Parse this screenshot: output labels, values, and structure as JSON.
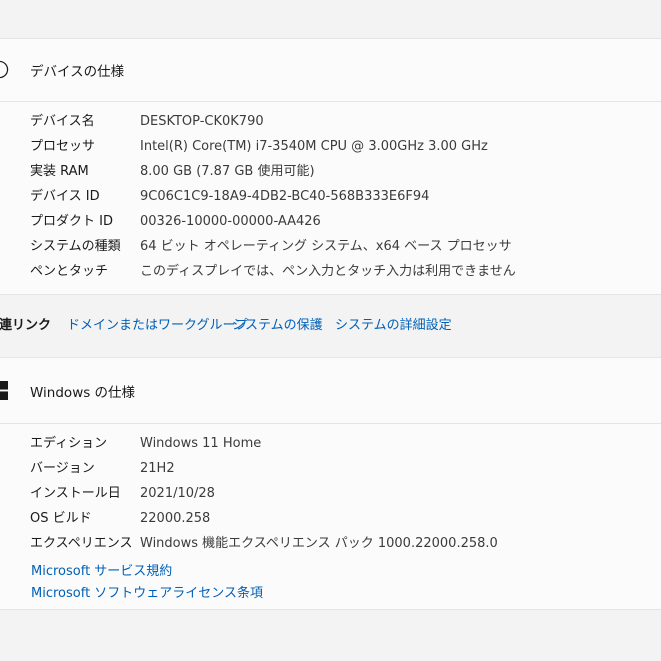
{
  "device_spec": {
    "title": "デバイスの仕様",
    "rows": [
      {
        "label": "デバイス名",
        "value": "DESKTOP-CK0K790"
      },
      {
        "label": "プロセッサ",
        "value": "Intel(R) Core(TM) i7-3540M CPU @ 3.00GHz   3.00 GHz"
      },
      {
        "label": "実装 RAM",
        "value": "8.00 GB (7.87 GB 使用可能)"
      },
      {
        "label": "デバイス ID",
        "value": "9C06C1C9-18A9-4DB2-BC40-568B333E6F94"
      },
      {
        "label": "プロダクト ID",
        "value": "00326-10000-00000-AA426"
      },
      {
        "label": "システムの種類",
        "value": "64 ビット オペレーティング システム、x64 ベース プロセッサ"
      },
      {
        "label": "ペンとタッチ",
        "value": "このディスプレイでは、ペン入力とタッチ入力は利用できません"
      }
    ]
  },
  "related_links": {
    "label": "関連リンク",
    "links": [
      "ドメインまたはワークグループ",
      "システムの保護",
      "システムの詳細設定"
    ]
  },
  "windows_spec": {
    "title": "Windows の仕様",
    "rows": [
      {
        "label": "エディション",
        "value": "Windows 11 Home"
      },
      {
        "label": "バージョン",
        "value": "21H2"
      },
      {
        "label": "インストール日",
        "value": "2021/10/28"
      },
      {
        "label": "OS ビルド",
        "value": "22000.258"
      },
      {
        "label": "エクスペリエンス",
        "value": "Windows 機能エクスペリエンス パック 1000.22000.258.0"
      }
    ],
    "links": [
      "Microsoft サービス規約",
      "Microsoft ソフトウェアライセンス条項"
    ]
  },
  "colors": {
    "link": "#0060b8",
    "card": "#fbfbfb",
    "page": "#f3f3f3"
  }
}
